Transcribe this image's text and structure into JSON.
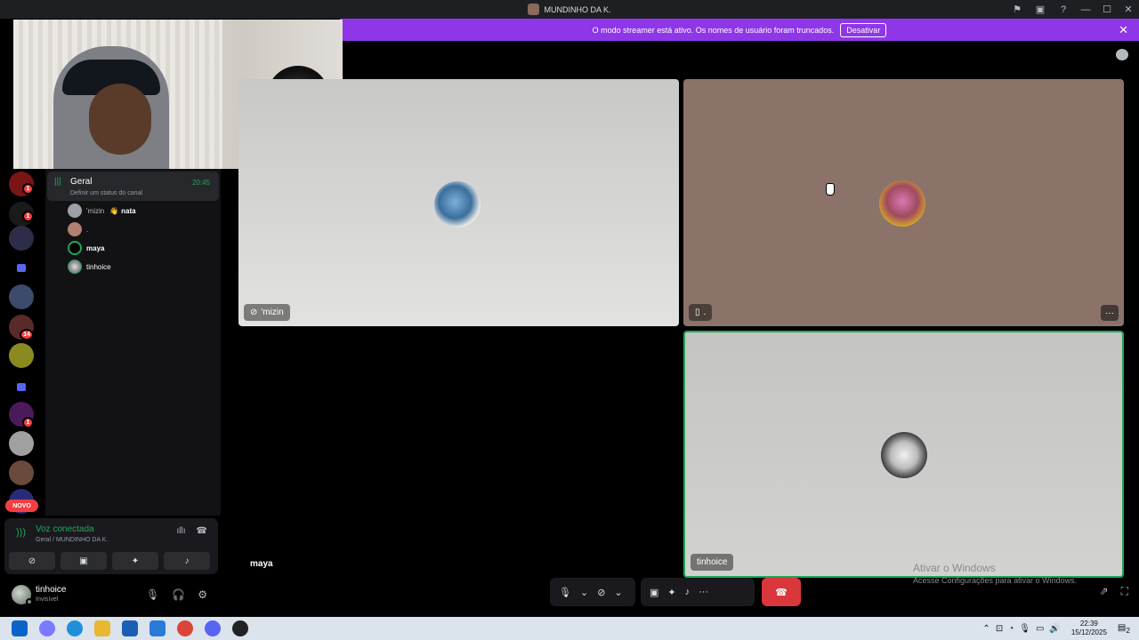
{
  "window": {
    "title": "MUNDINHO DA K.",
    "controls": [
      "⚑",
      "▣",
      "?",
      "—",
      "☐",
      "✕"
    ]
  },
  "streamer_banner": {
    "message": "O modo streamer está ativo. Os nomes de usuário foram truncados.",
    "disable_label": "Desativar",
    "close": "✕"
  },
  "server_rail": {
    "badges": [
      "1",
      "1",
      "14",
      "1"
    ],
    "new_label": "NOVO"
  },
  "channel": {
    "name": "Geral",
    "time": "20:45",
    "status_hint": "Definir um status do canal",
    "users": [
      {
        "name": "'mizin",
        "extra": "nata"
      },
      {
        "name": "."
      },
      {
        "name": "maya"
      },
      {
        "name": "tinhoice"
      }
    ]
  },
  "voice": {
    "status": "Voz conectada",
    "path": "Geral / MUNDINHO DA K."
  },
  "user_panel": {
    "name": "tinhoice",
    "status": "Invisível"
  },
  "tiles": [
    {
      "label": "'mizin",
      "bg": "#d8d8d6"
    },
    {
      "label": ".",
      "bg": "#8b736a"
    },
    {
      "label": "maya",
      "bg": "#000000"
    },
    {
      "label": "tinhoice",
      "bg": "#c9c9c7"
    }
  ],
  "windows_activation": {
    "title": "Ativar o Windows",
    "subtitle": "Acesse Configurações para ativar o Windows."
  },
  "taskbar": {
    "time": "22:39",
    "date": "15/12/2025",
    "notif_count": "2"
  }
}
